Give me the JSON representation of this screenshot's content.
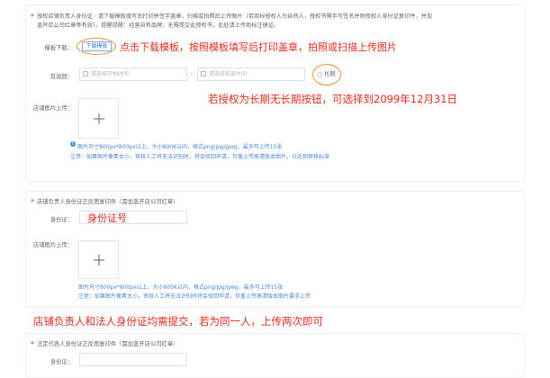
{
  "section1": {
    "required_mark": "*",
    "instruction_line1": "授权店铺负责人身份证 · 请下载模板填写后打印并签字盖章，扫描或拍照后上传图片（若商标授权人为自然人，授权书需手写签名并附授权人身份证复印件，并加",
    "instruction_line2": "盖开店公司红章等有效）。提醒提醒：经营自有品牌，无需提交此授权书，此处请上传商标注册证。",
    "template_label": "模板下载：",
    "template_button": "下载模板",
    "annotation_template": "点击下载模板，按照模板填写后打印盖章，拍照或扫描上传图片",
    "validity_label": "有效期：",
    "date_start_placeholder": "请选择开始时间",
    "date_separator": "-",
    "date_end_placeholder": "请选择结束时间",
    "long_term_label": "长期",
    "annotation_long_term": "若授权为长期无长期按钮，可选择到2099年12月31日",
    "upload_label": "店铺图片上传：",
    "upload_hint_line1": "图片尺寸800px*800px以上，大小800K以内，格式png/jpg/jpeg，最多可上传15张",
    "upload_hint_line2": "注意：如果图片像素太小，审核人工将无法识别时，将会驳回申请，尽量上传高清版本图片，以达到审核标准"
  },
  "section2": {
    "required_mark": "*",
    "title": "店铺负责人身份证正反面复印件（需加盖开店公司红章）",
    "id_label": "身份证：",
    "annotation_id": "身份证号",
    "upload_label": "店铺图片上传：",
    "upload_hint_line1": "图片尺寸800px*800px以上，大小800K以内，格式png/jpg/jpeg，最多可上传15张",
    "upload_hint_line2": "注意：如果图片像素太小，审核人工将无法识别时将会驳回申请，尽量上传高清版本图片要求上传"
  },
  "annotation_both": "店铺负责人和法人身份证均需提交，若为同一人，上传两次即可",
  "section3": {
    "required_mark": "*",
    "title": "法定代表人身份证正反面复印件（需加盖开店公司红章）",
    "id_label": "身份证："
  },
  "colors": {
    "annotation_red": "#e32d22",
    "accent_blue": "#3d8ae8",
    "circle_orange": "#f08a3b"
  }
}
